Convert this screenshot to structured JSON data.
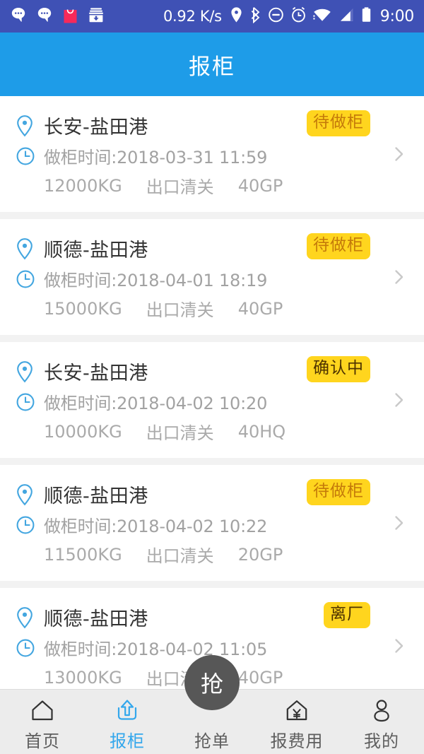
{
  "status_bar": {
    "background": "#3f51b5",
    "network_speed": "0.92 K/s",
    "time": "9:00",
    "left_icons": [
      "chat-bubble-icon",
      "chat-bubble-icon",
      "shopping-bag-icon",
      "archive-download-icon"
    ],
    "right_icons": [
      "location-pin-icon",
      "bluetooth-icon",
      "do-not-disturb-icon",
      "alarm-clock-icon",
      "wifi-icon",
      "cellular-signal-icon",
      "battery-icon"
    ],
    "shopping_bag_color": "#f7295a"
  },
  "header": {
    "title": "报柜",
    "background": "#1e9ce8",
    "title_color": "#ffffff"
  },
  "list": {
    "location_icon": "location-pin-icon",
    "time_icon": "clock-icon",
    "chevron_icon": "chevron-right-icon",
    "icon_color": "#43a6e0",
    "badge_background": "#ffd51e",
    "items": [
      {
        "route": "长安-盐田港",
        "time": "做柜时间:2018-03-31 11:59",
        "weight": "12000KG",
        "service": "出口清关",
        "container": "40GP",
        "status": "待做柜",
        "status_style": "light"
      },
      {
        "route": "顺德-盐田港",
        "time": "做柜时间:2018-04-01 18:19",
        "weight": "15000KG",
        "service": "出口清关",
        "container": "40GP",
        "status": "待做柜",
        "status_style": "light"
      },
      {
        "route": "长安-盐田港",
        "time": "做柜时间:2018-04-02 10:20",
        "weight": "10000KG",
        "service": "出口清关",
        "container": "40HQ",
        "status": "确认中",
        "status_style": "dark"
      },
      {
        "route": "顺德-盐田港",
        "time": "做柜时间:2018-04-02 10:22",
        "weight": "11500KG",
        "service": "出口清关",
        "container": "20GP",
        "status": "待做柜",
        "status_style": "light"
      },
      {
        "route": "顺德-盐田港",
        "time": "做柜时间:2018-04-02 11:05",
        "weight": "13000KG",
        "service": "出口清关",
        "container": "40GP",
        "status": "离厂",
        "status_style": "dark"
      }
    ]
  },
  "fab": {
    "label": "抢",
    "background": "#575757"
  },
  "tabbar": {
    "active_color": "#33a7ec",
    "inactive_color": "#5e5e5e",
    "items": [
      {
        "label": "首页",
        "icon": "home-icon",
        "active": false
      },
      {
        "label": "报柜",
        "icon": "upload-tray-icon",
        "active": true
      },
      {
        "label": "抢单",
        "icon": "grab-order-icon",
        "active": false
      },
      {
        "label": "报费用",
        "icon": "house-yuan-icon",
        "active": false
      },
      {
        "label": "我的",
        "icon": "person-icon",
        "active": false
      }
    ]
  }
}
